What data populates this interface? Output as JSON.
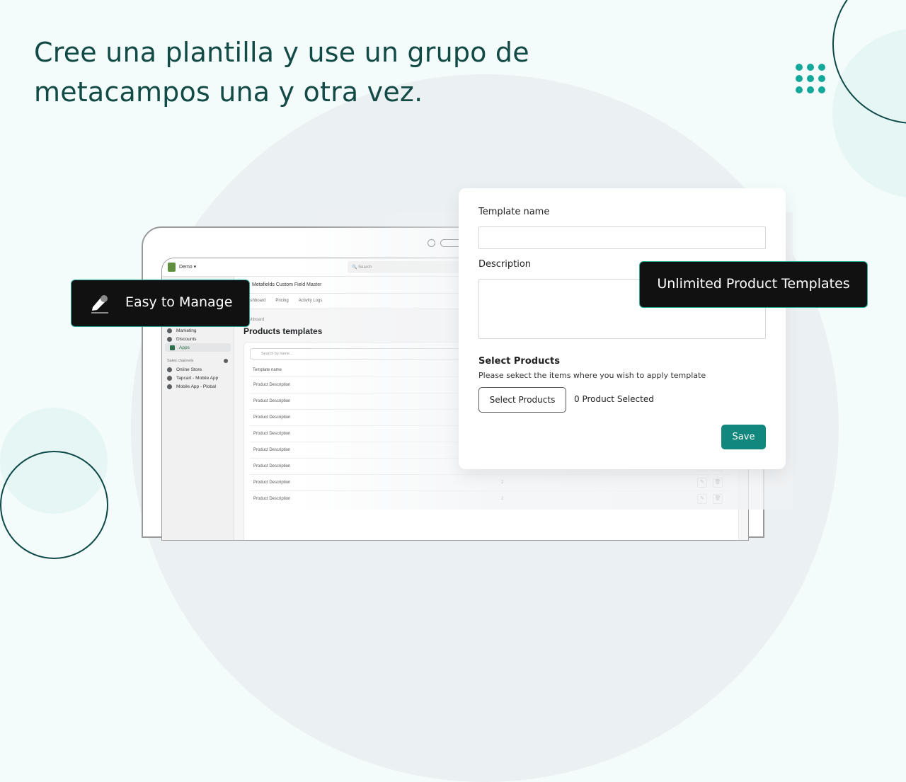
{
  "headline": "Cree una plantilla y use un grupo de metacampos una y otra vez.",
  "colors": {
    "accent": "#12877d",
    "heading": "#124a45",
    "dots": "#14a89c",
    "badge_bg": "#111111"
  },
  "badges": {
    "easy_to_manage": {
      "label": "Easy to Manage",
      "icon": "pencil-icon"
    },
    "unlimited": {
      "label": "Unlimited Product Templates"
    }
  },
  "admin": {
    "store_name": "Demo ▾",
    "search_placeholder": "Search",
    "app_title": "Metafields Custom Field Master",
    "tabs": [
      "Dashboard",
      "Pricing",
      "Activity Logs"
    ],
    "breadcrumb": "Dashboard",
    "page_title": "Products templates",
    "sidebar": {
      "items": [
        {
          "label": "Marketing",
          "icon": "marketing-icon"
        },
        {
          "label": "Discounts",
          "icon": "discount-icon"
        },
        {
          "label": "Apps",
          "icon": "apps-icon",
          "active": true
        }
      ],
      "sales_channels_label": "Sales channels",
      "channels": [
        {
          "label": "Online Store",
          "icon": "store-icon"
        },
        {
          "label": "Tapcart - Mobile App",
          "icon": "tapcart-icon"
        },
        {
          "label": "Mobile App - Plobal",
          "icon": "mobile-icon"
        }
      ]
    },
    "table": {
      "search_placeholder": "Search by name...",
      "header": "Template name",
      "rows": [
        {
          "name": "Product Description",
          "count": ""
        },
        {
          "name": "Product Description",
          "count": ""
        },
        {
          "name": "Product Description",
          "count": ""
        },
        {
          "name": "Product Description",
          "count": ""
        },
        {
          "name": "Product Description",
          "count": ""
        },
        {
          "name": "Product Description",
          "count": ""
        },
        {
          "name": "Product Description",
          "count": "2"
        },
        {
          "name": "Product Description",
          "count": "2"
        }
      ]
    }
  },
  "form": {
    "template_name_label": "Template name",
    "template_name_value": "",
    "description_label": "Description",
    "description_value": "",
    "select_products_title": "Select Products",
    "select_products_help": "Please sekect the items where you wish to apply template",
    "select_products_button": "Select Products",
    "selected_count": "0 Product Selected",
    "save_label": "Save"
  }
}
